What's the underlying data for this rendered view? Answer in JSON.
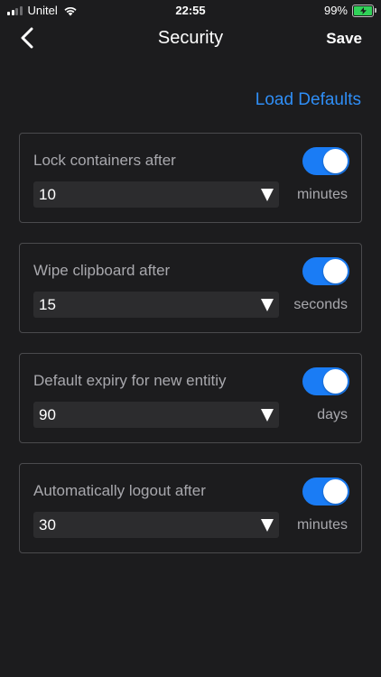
{
  "status_bar": {
    "carrier": "Unitel",
    "time": "22:55",
    "battery": "99%",
    "battery_color": "#30d158"
  },
  "nav": {
    "back_icon": "chevron-left-icon",
    "title": "Security",
    "save_label": "Save"
  },
  "load_defaults_label": "Load Defaults",
  "accent_color": "#1a7cf5",
  "settings": [
    {
      "label": "Lock containers after",
      "enabled": true,
      "value": "10",
      "unit": "minutes"
    },
    {
      "label": "Wipe clipboard after",
      "enabled": true,
      "value": "15",
      "unit": "seconds"
    },
    {
      "label": "Default expiry for new entitiy",
      "enabled": true,
      "value": "90",
      "unit": "days"
    },
    {
      "label": "Automatically logout after",
      "enabled": true,
      "value": "30",
      "unit": "minutes"
    }
  ]
}
